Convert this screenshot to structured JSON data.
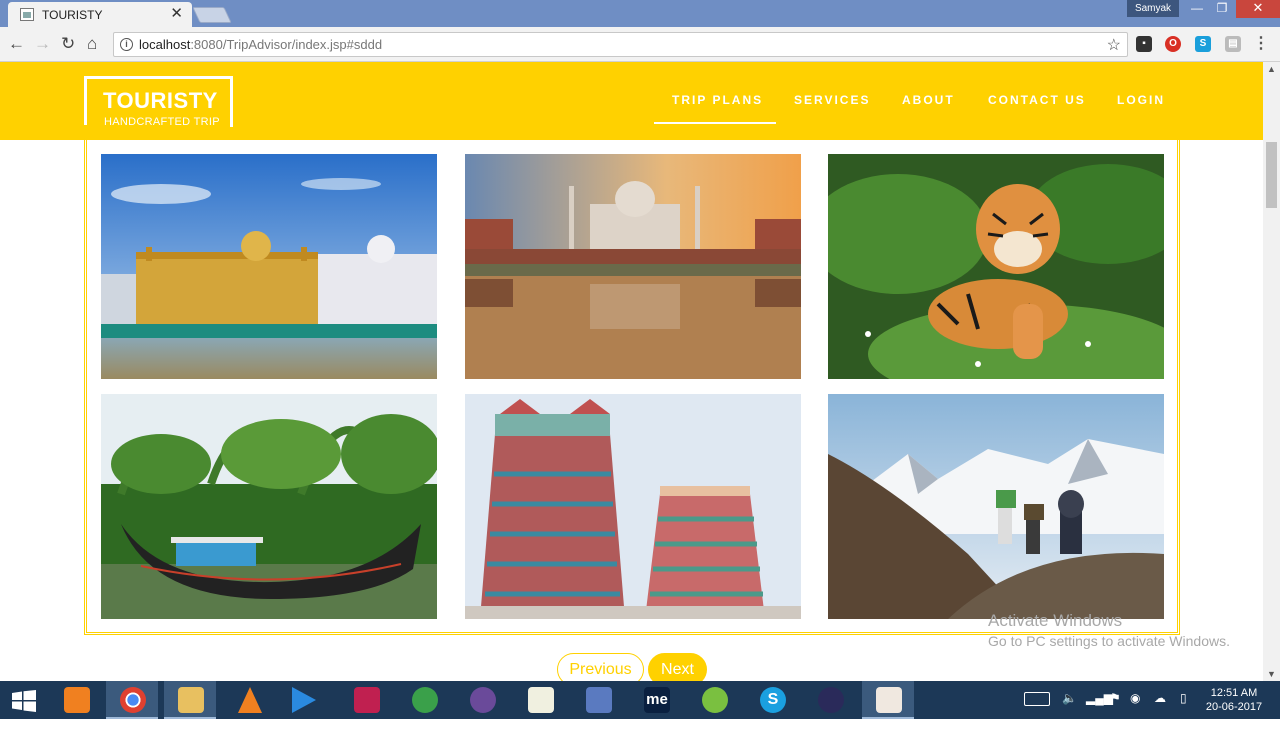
{
  "browser": {
    "tab_title": "TOURISTY",
    "tab_close": "✕",
    "user": "Samyak",
    "url_host": "localhost",
    "url_rest": ":8080/TripAdvisor/index.jsp#sddd",
    "window_controls": {
      "minimize": "—",
      "maximize": "❐",
      "close": "✕"
    }
  },
  "site": {
    "brand": "TOURISTY",
    "tagline": "HANDCRAFTED TRIP",
    "nav": [
      {
        "label": "TRIP PLANS",
        "active": true
      },
      {
        "label": "SERVICES",
        "active": false
      },
      {
        "label": "ABOUT",
        "active": false
      },
      {
        "label": "CONTACT US",
        "active": false
      },
      {
        "label": "LOGIN",
        "active": false
      }
    ],
    "gallery": [
      {
        "subject": "golden-temple"
      },
      {
        "subject": "taj-mahal"
      },
      {
        "subject": "tiger"
      },
      {
        "subject": "kerala-houseboat"
      },
      {
        "subject": "meenakshi-temple"
      },
      {
        "subject": "himalaya-trekkers"
      }
    ],
    "pager": {
      "previous": "Previous",
      "next": "Next"
    }
  },
  "watermark": {
    "line1": "Activate Windows",
    "line2": "Go to PC settings to activate Windows."
  },
  "taskbar": {
    "time": "12:51 AM",
    "date": "20-06-2017"
  },
  "colors": {
    "accent": "#ffd100",
    "taskbar": "#1c3857",
    "titlebar": "#6f8ec4"
  }
}
